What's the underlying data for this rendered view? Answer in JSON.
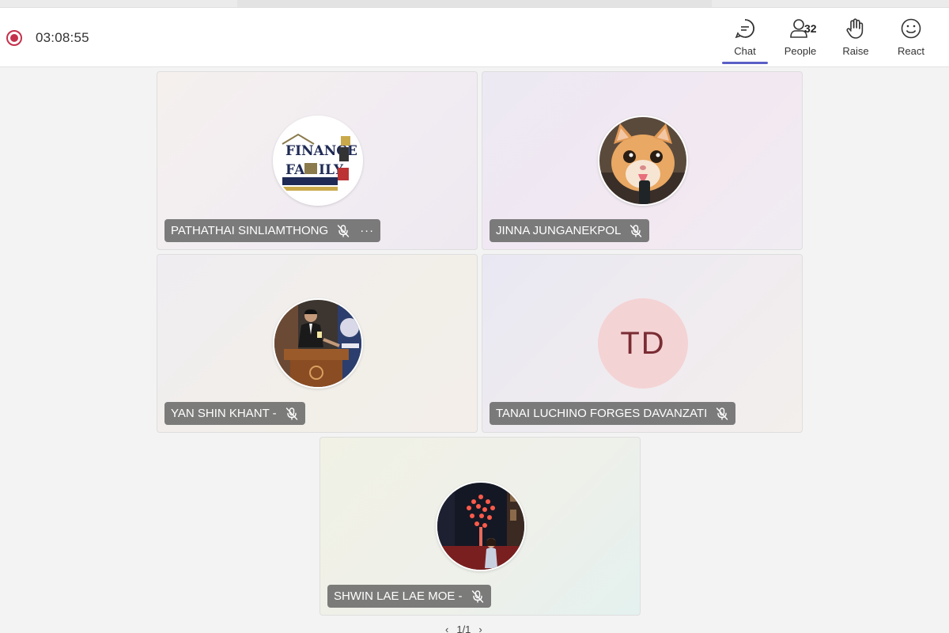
{
  "meeting": {
    "timer": "03:08:55"
  },
  "toolbar": {
    "chat_label": "Chat",
    "people_label": "People",
    "people_count": "32",
    "raise_label": "Raise",
    "react_label": "React",
    "icons": {
      "record": "record-icon",
      "chat": "chat-icon",
      "people": "people-icon",
      "raise": "hand-icon",
      "react": "smiley-icon"
    },
    "accent_color": "#5b5fc7",
    "record_color": "#c4314b"
  },
  "participants": [
    {
      "name": "PATHATHAI SINLIAMTHONG",
      "muted": true,
      "has_more": true,
      "avatar": "finance-family-logo"
    },
    {
      "name": "JINNA JUNGANEKPOL",
      "muted": true,
      "has_more": false,
      "avatar": "cat-photo"
    },
    {
      "name": "YAN SHIN KHANT -",
      "muted": true,
      "has_more": false,
      "avatar": "podium-photo"
    },
    {
      "name": "TANAI LUCHINO FORGES DAVANZATI",
      "muted": true,
      "has_more": false,
      "avatar_initials": "TD",
      "avatar_color": "#f4d3d5"
    },
    {
      "name": "SHWIN LAE LAE MOE -",
      "muted": true,
      "has_more": false,
      "avatar": "night-tree-photo"
    }
  ],
  "pager": {
    "label": "1/1"
  }
}
